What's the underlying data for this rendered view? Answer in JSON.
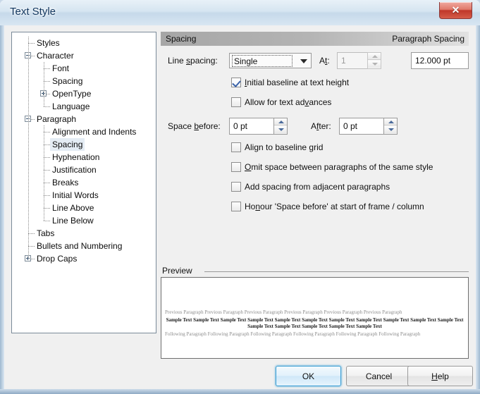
{
  "window": {
    "title": "Text Style",
    "close_label": "✕"
  },
  "tree": {
    "items": [
      {
        "label": "Styles",
        "depth": 0,
        "toggle": "none",
        "selected": false
      },
      {
        "label": "Character",
        "depth": 0,
        "toggle": "minus",
        "selected": false
      },
      {
        "label": "Font",
        "depth": 1,
        "toggle": "none",
        "selected": false
      },
      {
        "label": "Spacing",
        "depth": 1,
        "toggle": "none",
        "selected": false
      },
      {
        "label": "OpenType",
        "depth": 1,
        "toggle": "plus",
        "selected": false
      },
      {
        "label": "Language",
        "depth": 1,
        "toggle": "none",
        "selected": false
      },
      {
        "label": "Paragraph",
        "depth": 0,
        "toggle": "minus",
        "selected": false
      },
      {
        "label": "Alignment and Indents",
        "depth": 1,
        "toggle": "none",
        "selected": false
      },
      {
        "label": "Spacing",
        "depth": 1,
        "toggle": "none",
        "selected": true
      },
      {
        "label": "Hyphenation",
        "depth": 1,
        "toggle": "none",
        "selected": false
      },
      {
        "label": "Justification",
        "depth": 1,
        "toggle": "none",
        "selected": false
      },
      {
        "label": "Breaks",
        "depth": 1,
        "toggle": "none",
        "selected": false
      },
      {
        "label": "Initial Words",
        "depth": 1,
        "toggle": "none",
        "selected": false
      },
      {
        "label": "Line Above",
        "depth": 1,
        "toggle": "none",
        "selected": false
      },
      {
        "label": "Line Below",
        "depth": 1,
        "toggle": "none",
        "selected": false
      },
      {
        "label": "Tabs",
        "depth": 0,
        "toggle": "none",
        "selected": false
      },
      {
        "label": "Bullets and Numbering",
        "depth": 0,
        "toggle": "none",
        "selected": false
      },
      {
        "label": "Drop Caps",
        "depth": 0,
        "toggle": "plus",
        "selected": false
      }
    ]
  },
  "section": {
    "header_left": "Spacing",
    "header_right": "Paragraph Spacing"
  },
  "line_spacing": {
    "label": "Line spacing:",
    "label_accel": "s",
    "value": "Single",
    "options": [
      "Single"
    ],
    "at_label": "At:",
    "at_accel": "t",
    "at_value": "1",
    "at_enabled": false,
    "computed_value": "12.000 pt"
  },
  "baseline_options": [
    {
      "label": "Initial baseline at text height",
      "accel": "I",
      "checked": true
    },
    {
      "label": "Allow for text advances",
      "accel": "v",
      "checked": false
    }
  ],
  "space": {
    "before_label": "Space before:",
    "before_accel": "b",
    "before_value": "0 pt",
    "after_label": "After:",
    "after_accel": "f",
    "after_value": "0 pt"
  },
  "paragraph_options": [
    {
      "label": "Align to baseline grid",
      "accel": "g",
      "checked": false
    },
    {
      "label": "Omit space between paragraphs of the same style",
      "accel": "O",
      "checked": false
    },
    {
      "label": "Add spacing from adjacent paragraphs",
      "accel": "j",
      "checked": false
    },
    {
      "label": "Honour 'Space before' at start of frame / column",
      "accel": "n",
      "checked": false
    }
  ],
  "preview": {
    "title": "Preview",
    "previous_text": "Previous Paragraph Previous Paragraph Previous Paragraph Previous Paragraph Previous Paragraph Previous Paragraph",
    "sample_text": "Sample Text Sample Text Sample Text Sample Text Sample Text Sample Text Sample Text Sample Text Sample Text Sample Text Sample Text Sample Text Sample Text Sample Text Sample Text Sample Text",
    "following_text": "Following Paragraph Following Paragraph Following Paragraph Following Paragraph Following Paragraph Following Paragraph"
  },
  "buttons": {
    "ok": "OK",
    "cancel": "Cancel",
    "help": "Help",
    "help_accel": "H"
  },
  "colors": {
    "accent": "#3c9fd4",
    "title_text": "#13375e",
    "close_red": "#c0372a",
    "selection": "#e4ecf4",
    "check_blue": "#3a62a8"
  }
}
